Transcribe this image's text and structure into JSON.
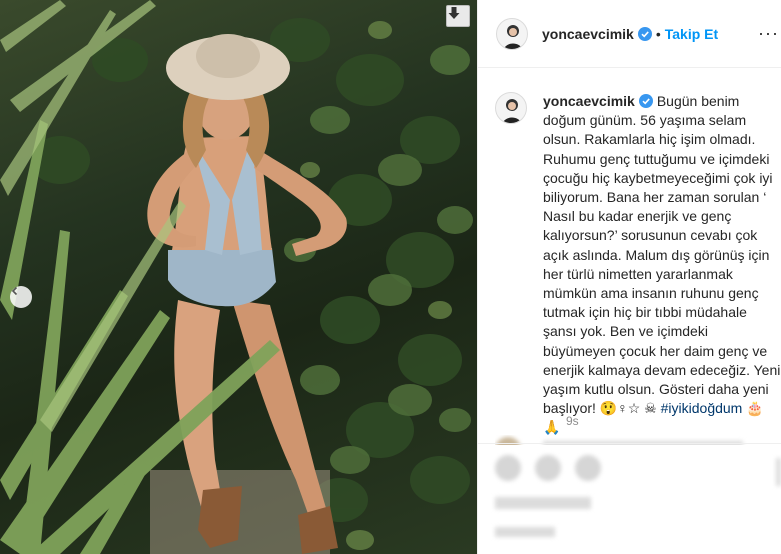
{
  "post": {
    "username": "yoncaevcimik",
    "follow_label": "Takip Et",
    "separator": "•",
    "more_label": "···",
    "caption_username": "yoncaevcimik",
    "caption_body": "Bugün benim doğum günüm. 56 yaşıma selam olsun. Rakamlarla hiç işim olmadı. Ruhumu genç tuttuğumu ve içimdeki çocuğu hiç kaybetmeyeceğimi çok iyi biliyorum. Bana her zaman sorulan ‘ Nasıl bu kadar enerjik ve genç kalıyorsun?’ sorusunun cevabı çok açık aslında. Malum dış görünüş için her türlü nimetten yararlanmak mümkün ama insanın ruhunu genç tutmak için hiç bir tıbbi müdahale şansı yok. Ben ve içimdeki büyümeyen çocuk her daim genç ve enerjik kalmaya devam edeceğiz. Yeni yaşım kutlu olsun. Gösteri daha yeni başlıyor! 😲♀☆ ☠ ",
    "hashtag": "#iyikidoğdum",
    "hashtag_emoji": " 🎂🙏",
    "timestamp": "9s"
  },
  "icons": {
    "download": "download-arrow-icon",
    "prev": "chevron-left-icon",
    "verified": "verified-badge-icon"
  },
  "colors": {
    "accent": "#0095f6",
    "verified": "#3897f0",
    "hashtag": "#00376b",
    "muted": "#8e8e8e"
  }
}
